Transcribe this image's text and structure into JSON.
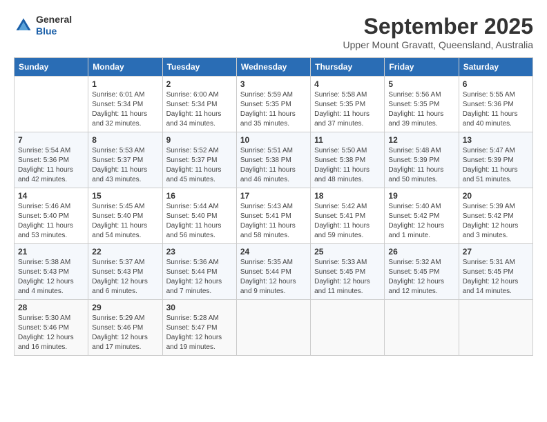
{
  "header": {
    "logo": {
      "line1": "General",
      "line2": "Blue"
    },
    "title": "September 2025",
    "location": "Upper Mount Gravatt, Queensland, Australia"
  },
  "weekdays": [
    "Sunday",
    "Monday",
    "Tuesday",
    "Wednesday",
    "Thursday",
    "Friday",
    "Saturday"
  ],
  "weeks": [
    [
      {
        "day": "",
        "sunrise": "",
        "sunset": "",
        "daylight": ""
      },
      {
        "day": "1",
        "sunrise": "Sunrise: 6:01 AM",
        "sunset": "Sunset: 5:34 PM",
        "daylight": "Daylight: 11 hours and 32 minutes."
      },
      {
        "day": "2",
        "sunrise": "Sunrise: 6:00 AM",
        "sunset": "Sunset: 5:34 PM",
        "daylight": "Daylight: 11 hours and 34 minutes."
      },
      {
        "day": "3",
        "sunrise": "Sunrise: 5:59 AM",
        "sunset": "Sunset: 5:35 PM",
        "daylight": "Daylight: 11 hours and 35 minutes."
      },
      {
        "day": "4",
        "sunrise": "Sunrise: 5:58 AM",
        "sunset": "Sunset: 5:35 PM",
        "daylight": "Daylight: 11 hours and 37 minutes."
      },
      {
        "day": "5",
        "sunrise": "Sunrise: 5:56 AM",
        "sunset": "Sunset: 5:35 PM",
        "daylight": "Daylight: 11 hours and 39 minutes."
      },
      {
        "day": "6",
        "sunrise": "Sunrise: 5:55 AM",
        "sunset": "Sunset: 5:36 PM",
        "daylight": "Daylight: 11 hours and 40 minutes."
      }
    ],
    [
      {
        "day": "7",
        "sunrise": "Sunrise: 5:54 AM",
        "sunset": "Sunset: 5:36 PM",
        "daylight": "Daylight: 11 hours and 42 minutes."
      },
      {
        "day": "8",
        "sunrise": "Sunrise: 5:53 AM",
        "sunset": "Sunset: 5:37 PM",
        "daylight": "Daylight: 11 hours and 43 minutes."
      },
      {
        "day": "9",
        "sunrise": "Sunrise: 5:52 AM",
        "sunset": "Sunset: 5:37 PM",
        "daylight": "Daylight: 11 hours and 45 minutes."
      },
      {
        "day": "10",
        "sunrise": "Sunrise: 5:51 AM",
        "sunset": "Sunset: 5:38 PM",
        "daylight": "Daylight: 11 hours and 46 minutes."
      },
      {
        "day": "11",
        "sunrise": "Sunrise: 5:50 AM",
        "sunset": "Sunset: 5:38 PM",
        "daylight": "Daylight: 11 hours and 48 minutes."
      },
      {
        "day": "12",
        "sunrise": "Sunrise: 5:48 AM",
        "sunset": "Sunset: 5:39 PM",
        "daylight": "Daylight: 11 hours and 50 minutes."
      },
      {
        "day": "13",
        "sunrise": "Sunrise: 5:47 AM",
        "sunset": "Sunset: 5:39 PM",
        "daylight": "Daylight: 11 hours and 51 minutes."
      }
    ],
    [
      {
        "day": "14",
        "sunrise": "Sunrise: 5:46 AM",
        "sunset": "Sunset: 5:40 PM",
        "daylight": "Daylight: 11 hours and 53 minutes."
      },
      {
        "day": "15",
        "sunrise": "Sunrise: 5:45 AM",
        "sunset": "Sunset: 5:40 PM",
        "daylight": "Daylight: 11 hours and 54 minutes."
      },
      {
        "day": "16",
        "sunrise": "Sunrise: 5:44 AM",
        "sunset": "Sunset: 5:40 PM",
        "daylight": "Daylight: 11 hours and 56 minutes."
      },
      {
        "day": "17",
        "sunrise": "Sunrise: 5:43 AM",
        "sunset": "Sunset: 5:41 PM",
        "daylight": "Daylight: 11 hours and 58 minutes."
      },
      {
        "day": "18",
        "sunrise": "Sunrise: 5:42 AM",
        "sunset": "Sunset: 5:41 PM",
        "daylight": "Daylight: 11 hours and 59 minutes."
      },
      {
        "day": "19",
        "sunrise": "Sunrise: 5:40 AM",
        "sunset": "Sunset: 5:42 PM",
        "daylight": "Daylight: 12 hours and 1 minute."
      },
      {
        "day": "20",
        "sunrise": "Sunrise: 5:39 AM",
        "sunset": "Sunset: 5:42 PM",
        "daylight": "Daylight: 12 hours and 3 minutes."
      }
    ],
    [
      {
        "day": "21",
        "sunrise": "Sunrise: 5:38 AM",
        "sunset": "Sunset: 5:43 PM",
        "daylight": "Daylight: 12 hours and 4 minutes."
      },
      {
        "day": "22",
        "sunrise": "Sunrise: 5:37 AM",
        "sunset": "Sunset: 5:43 PM",
        "daylight": "Daylight: 12 hours and 6 minutes."
      },
      {
        "day": "23",
        "sunrise": "Sunrise: 5:36 AM",
        "sunset": "Sunset: 5:44 PM",
        "daylight": "Daylight: 12 hours and 7 minutes."
      },
      {
        "day": "24",
        "sunrise": "Sunrise: 5:35 AM",
        "sunset": "Sunset: 5:44 PM",
        "daylight": "Daylight: 12 hours and 9 minutes."
      },
      {
        "day": "25",
        "sunrise": "Sunrise: 5:33 AM",
        "sunset": "Sunset: 5:45 PM",
        "daylight": "Daylight: 12 hours and 11 minutes."
      },
      {
        "day": "26",
        "sunrise": "Sunrise: 5:32 AM",
        "sunset": "Sunset: 5:45 PM",
        "daylight": "Daylight: 12 hours and 12 minutes."
      },
      {
        "day": "27",
        "sunrise": "Sunrise: 5:31 AM",
        "sunset": "Sunset: 5:45 PM",
        "daylight": "Daylight: 12 hours and 14 minutes."
      }
    ],
    [
      {
        "day": "28",
        "sunrise": "Sunrise: 5:30 AM",
        "sunset": "Sunset: 5:46 PM",
        "daylight": "Daylight: 12 hours and 16 minutes."
      },
      {
        "day": "29",
        "sunrise": "Sunrise: 5:29 AM",
        "sunset": "Sunset: 5:46 PM",
        "daylight": "Daylight: 12 hours and 17 minutes."
      },
      {
        "day": "30",
        "sunrise": "Sunrise: 5:28 AM",
        "sunset": "Sunset: 5:47 PM",
        "daylight": "Daylight: 12 hours and 19 minutes."
      },
      {
        "day": "",
        "sunrise": "",
        "sunset": "",
        "daylight": ""
      },
      {
        "day": "",
        "sunrise": "",
        "sunset": "",
        "daylight": ""
      },
      {
        "day": "",
        "sunrise": "",
        "sunset": "",
        "daylight": ""
      },
      {
        "day": "",
        "sunrise": "",
        "sunset": "",
        "daylight": ""
      }
    ]
  ]
}
